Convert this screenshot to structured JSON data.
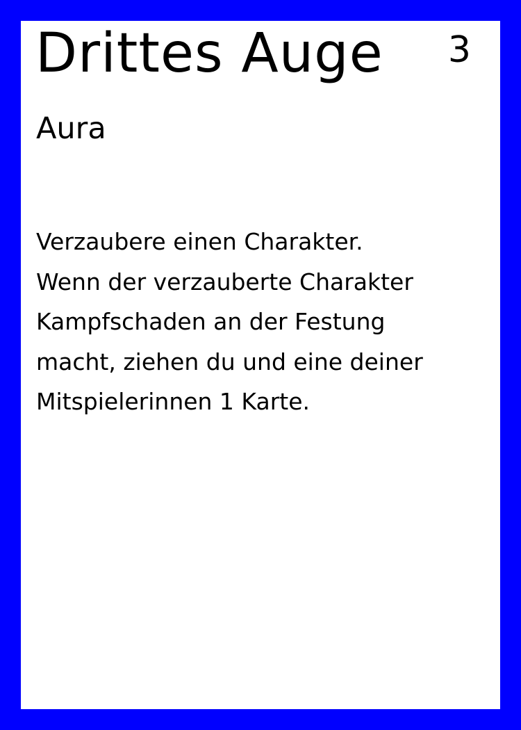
{
  "card": {
    "title": "Drittes Auge",
    "cost": "3",
    "type": "Aura",
    "text_lines": [
      "Verzaubere einen Charakter.",
      "Wenn der verzauberte Charakter",
      "Kampfschaden an der Festung",
      "macht, ziehen du und eine deiner",
      "Mitspielerinnen 1 Karte."
    ],
    "border_color": "#0000ff",
    "background_color": "#ffffff"
  }
}
